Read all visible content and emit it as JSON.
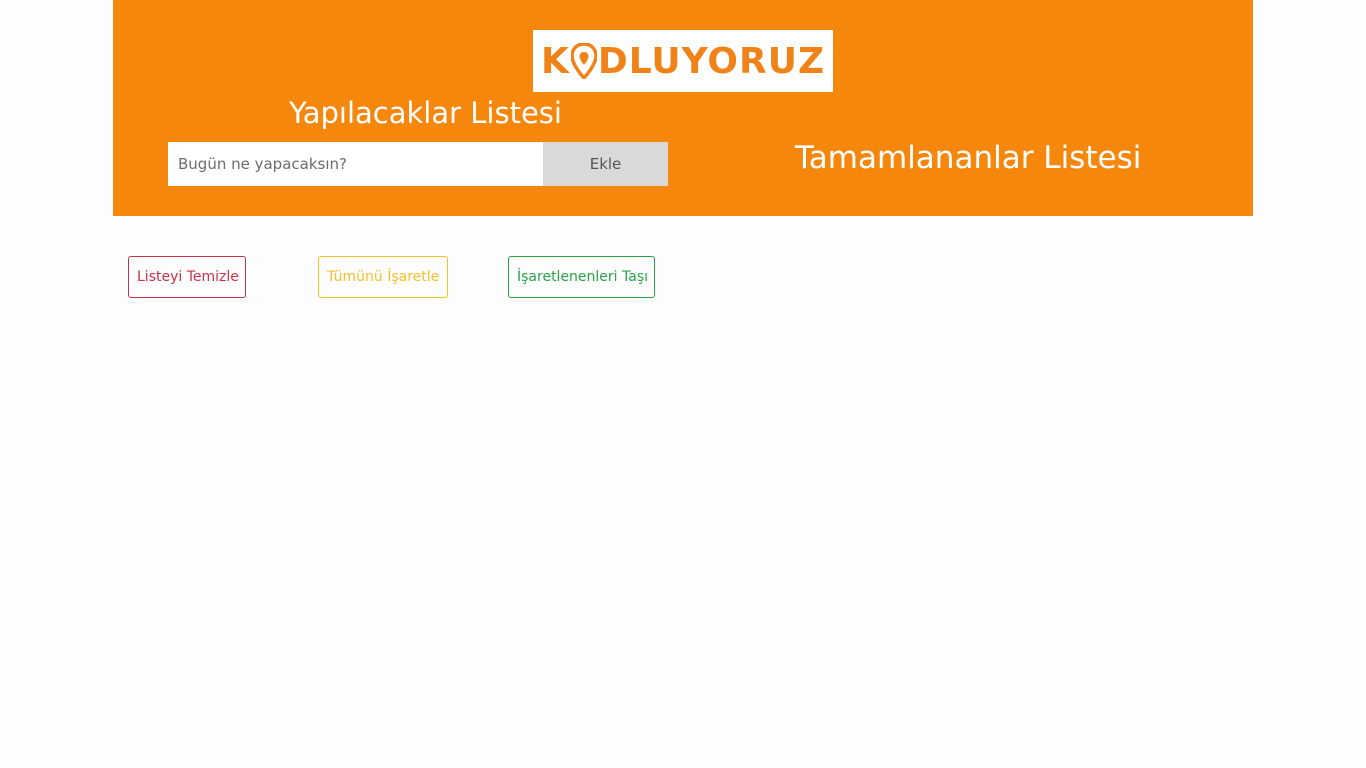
{
  "header": {
    "logo_text_left": "K",
    "logo_text_right": "DLUYORUZ",
    "todo_title": "Yapılacaklar Listesi",
    "done_title": "Tamamlananlar Listesi"
  },
  "form": {
    "input_placeholder": "Bugün ne yapacaksın?",
    "input_value": "",
    "add_label": "Ekle"
  },
  "actions": {
    "clear_label": "Listeyi Temizle",
    "mark_all_label": "Tümünü İşaretle",
    "move_marked_label": "İşaretlenenleri Taşı"
  },
  "colors": {
    "header_bg": "#f5870d",
    "brand": "#f08318",
    "danger": "#c8334b",
    "warning": "#f3c12a",
    "success": "#2aa24a"
  },
  "icons": {
    "logo_o": "location-pin-icon"
  }
}
